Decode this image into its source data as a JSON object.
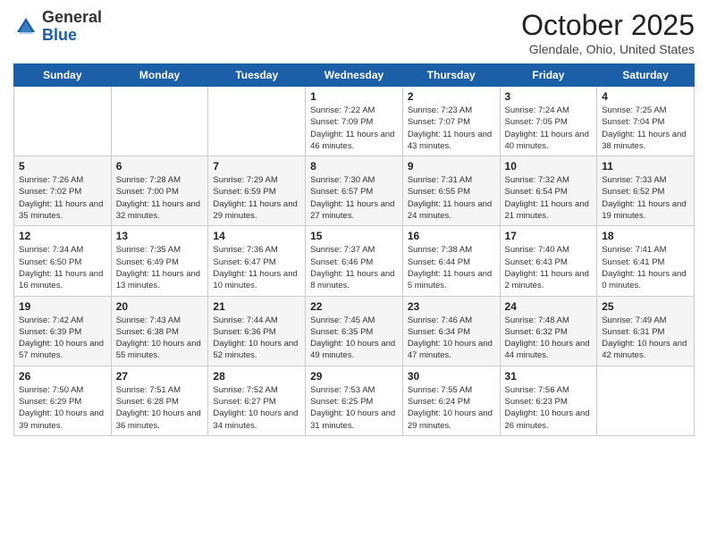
{
  "logo": {
    "general": "General",
    "blue": "Blue"
  },
  "header": {
    "month": "October 2025",
    "location": "Glendale, Ohio, United States"
  },
  "days_of_week": [
    "Sunday",
    "Monday",
    "Tuesday",
    "Wednesday",
    "Thursday",
    "Friday",
    "Saturday"
  ],
  "weeks": [
    [
      {
        "day": "",
        "info": ""
      },
      {
        "day": "",
        "info": ""
      },
      {
        "day": "",
        "info": ""
      },
      {
        "day": "1",
        "info": "Sunrise: 7:22 AM\nSunset: 7:09 PM\nDaylight: 11 hours and 46 minutes."
      },
      {
        "day": "2",
        "info": "Sunrise: 7:23 AM\nSunset: 7:07 PM\nDaylight: 11 hours and 43 minutes."
      },
      {
        "day": "3",
        "info": "Sunrise: 7:24 AM\nSunset: 7:05 PM\nDaylight: 11 hours and 40 minutes."
      },
      {
        "day": "4",
        "info": "Sunrise: 7:25 AM\nSunset: 7:04 PM\nDaylight: 11 hours and 38 minutes."
      }
    ],
    [
      {
        "day": "5",
        "info": "Sunrise: 7:26 AM\nSunset: 7:02 PM\nDaylight: 11 hours and 35 minutes."
      },
      {
        "day": "6",
        "info": "Sunrise: 7:28 AM\nSunset: 7:00 PM\nDaylight: 11 hours and 32 minutes."
      },
      {
        "day": "7",
        "info": "Sunrise: 7:29 AM\nSunset: 6:59 PM\nDaylight: 11 hours and 29 minutes."
      },
      {
        "day": "8",
        "info": "Sunrise: 7:30 AM\nSunset: 6:57 PM\nDaylight: 11 hours and 27 minutes."
      },
      {
        "day": "9",
        "info": "Sunrise: 7:31 AM\nSunset: 6:55 PM\nDaylight: 11 hours and 24 minutes."
      },
      {
        "day": "10",
        "info": "Sunrise: 7:32 AM\nSunset: 6:54 PM\nDaylight: 11 hours and 21 minutes."
      },
      {
        "day": "11",
        "info": "Sunrise: 7:33 AM\nSunset: 6:52 PM\nDaylight: 11 hours and 19 minutes."
      }
    ],
    [
      {
        "day": "12",
        "info": "Sunrise: 7:34 AM\nSunset: 6:50 PM\nDaylight: 11 hours and 16 minutes."
      },
      {
        "day": "13",
        "info": "Sunrise: 7:35 AM\nSunset: 6:49 PM\nDaylight: 11 hours and 13 minutes."
      },
      {
        "day": "14",
        "info": "Sunrise: 7:36 AM\nSunset: 6:47 PM\nDaylight: 11 hours and 10 minutes."
      },
      {
        "day": "15",
        "info": "Sunrise: 7:37 AM\nSunset: 6:46 PM\nDaylight: 11 hours and 8 minutes."
      },
      {
        "day": "16",
        "info": "Sunrise: 7:38 AM\nSunset: 6:44 PM\nDaylight: 11 hours and 5 minutes."
      },
      {
        "day": "17",
        "info": "Sunrise: 7:40 AM\nSunset: 6:43 PM\nDaylight: 11 hours and 2 minutes."
      },
      {
        "day": "18",
        "info": "Sunrise: 7:41 AM\nSunset: 6:41 PM\nDaylight: 11 hours and 0 minutes."
      }
    ],
    [
      {
        "day": "19",
        "info": "Sunrise: 7:42 AM\nSunset: 6:39 PM\nDaylight: 10 hours and 57 minutes."
      },
      {
        "day": "20",
        "info": "Sunrise: 7:43 AM\nSunset: 6:38 PM\nDaylight: 10 hours and 55 minutes."
      },
      {
        "day": "21",
        "info": "Sunrise: 7:44 AM\nSunset: 6:36 PM\nDaylight: 10 hours and 52 minutes."
      },
      {
        "day": "22",
        "info": "Sunrise: 7:45 AM\nSunset: 6:35 PM\nDaylight: 10 hours and 49 minutes."
      },
      {
        "day": "23",
        "info": "Sunrise: 7:46 AM\nSunset: 6:34 PM\nDaylight: 10 hours and 47 minutes."
      },
      {
        "day": "24",
        "info": "Sunrise: 7:48 AM\nSunset: 6:32 PM\nDaylight: 10 hours and 44 minutes."
      },
      {
        "day": "25",
        "info": "Sunrise: 7:49 AM\nSunset: 6:31 PM\nDaylight: 10 hours and 42 minutes."
      }
    ],
    [
      {
        "day": "26",
        "info": "Sunrise: 7:50 AM\nSunset: 6:29 PM\nDaylight: 10 hours and 39 minutes."
      },
      {
        "day": "27",
        "info": "Sunrise: 7:51 AM\nSunset: 6:28 PM\nDaylight: 10 hours and 36 minutes."
      },
      {
        "day": "28",
        "info": "Sunrise: 7:52 AM\nSunset: 6:27 PM\nDaylight: 10 hours and 34 minutes."
      },
      {
        "day": "29",
        "info": "Sunrise: 7:53 AM\nSunset: 6:25 PM\nDaylight: 10 hours and 31 minutes."
      },
      {
        "day": "30",
        "info": "Sunrise: 7:55 AM\nSunset: 6:24 PM\nDaylight: 10 hours and 29 minutes."
      },
      {
        "day": "31",
        "info": "Sunrise: 7:56 AM\nSunset: 6:23 PM\nDaylight: 10 hours and 26 minutes."
      },
      {
        "day": "",
        "info": ""
      }
    ]
  ]
}
